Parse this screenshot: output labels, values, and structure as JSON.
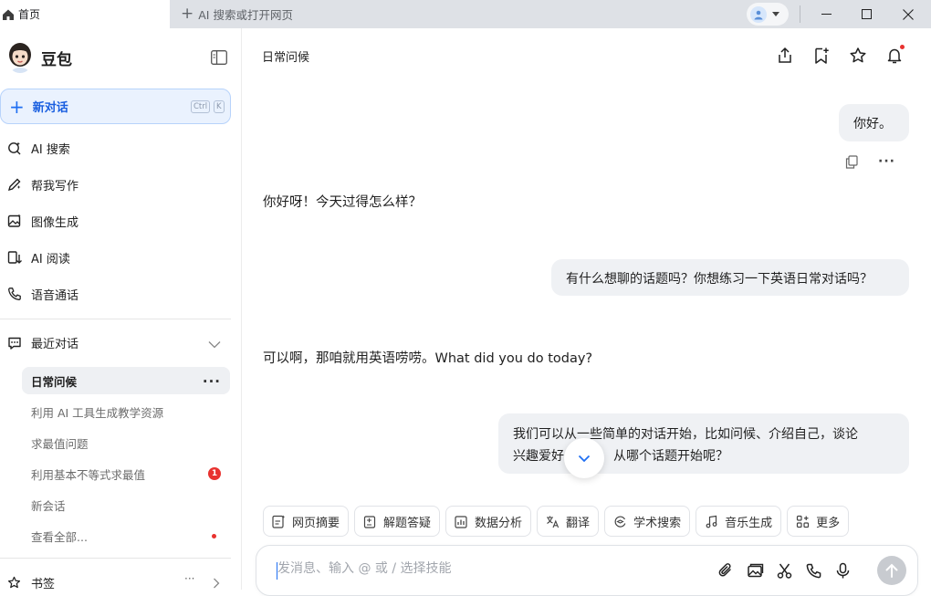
{
  "browser": {
    "active_tab": "首页",
    "new_tab_label": "AI 搜索或打开网页"
  },
  "sidebar": {
    "brand": "豆包",
    "new_chat": {
      "label": "新对话",
      "shortcut": [
        "Ctrl",
        "K"
      ]
    },
    "nav": [
      {
        "label": "AI 搜索",
        "icon": "ai-search-icon"
      },
      {
        "label": "帮我写作",
        "icon": "write-icon"
      },
      {
        "label": "图像生成",
        "icon": "image-gen-icon"
      },
      {
        "label": "AI 阅读",
        "icon": "ai-read-icon"
      },
      {
        "label": "语音通话",
        "icon": "phone-icon"
      }
    ],
    "recent_title": "最近对话",
    "recent": [
      {
        "title": "日常问候"
      },
      {
        "title": "利用 AI 工具生成教学资源"
      },
      {
        "title": "求最值问题"
      },
      {
        "title": "利用基本不等式求最值",
        "badge": "1"
      },
      {
        "title": "新会话"
      },
      {
        "title": "查看全部..."
      }
    ],
    "bookmarks": "书签",
    "bookmarks_more": "···"
  },
  "main": {
    "title": "日常问候",
    "more_dots": "···",
    "messages": [
      {
        "role": "user",
        "text": "你好。"
      },
      {
        "role": "bot",
        "text": "你好呀！今天过得怎么样？"
      },
      {
        "role": "user",
        "text": "有什么想聊的话题吗？你想练习一下英语日常对话吗？"
      },
      {
        "role": "bot",
        "text": "可以啊，那咱就用英语唠唠。What did you do today?"
      },
      {
        "role": "user",
        "text_line1": "我们可以从一些简单的对话开始，比如问候、介绍自己，谈论",
        "text_line2": "兴趣爱好",
        "text_line2b": "从哪个话题开始呢？"
      }
    ],
    "skills": [
      {
        "label": "网页摘要",
        "icon": "web-summary-icon"
      },
      {
        "label": "解题答疑",
        "icon": "solve-icon"
      },
      {
        "label": "数据分析",
        "icon": "data-analysis-icon"
      },
      {
        "label": "翻译",
        "icon": "translate-icon"
      },
      {
        "label": "学术搜索",
        "icon": "academic-search-icon"
      },
      {
        "label": "音乐生成",
        "icon": "music-icon"
      },
      {
        "label": "更多",
        "icon": "more-grid-icon"
      }
    ],
    "input_placeholder": "发消息、输入 @ 或 / 选择技能"
  },
  "colors": {
    "accent": "#1f6ff2",
    "new_chat_bg": "#eaf2fe",
    "alert_red": "#e8322f",
    "bubble_bg": "#eff1f4"
  }
}
